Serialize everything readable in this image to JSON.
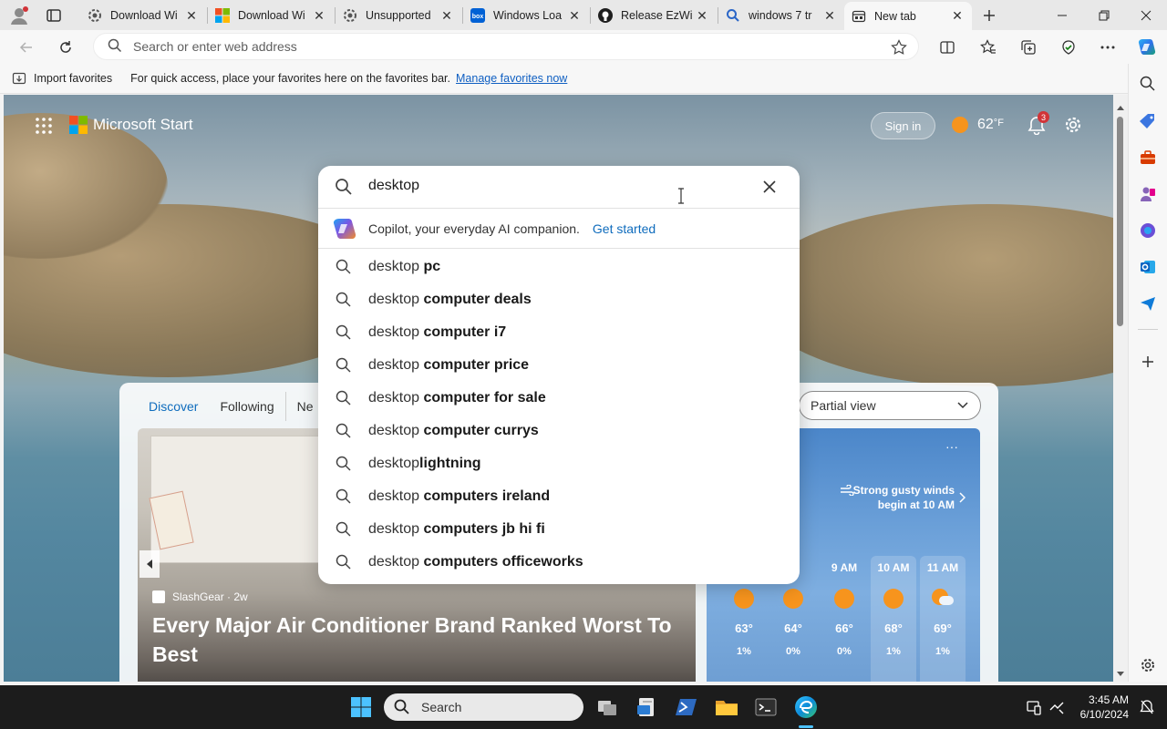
{
  "browser": {
    "tabs": [
      {
        "label": "Download Wi",
        "icon": "gear-icon"
      },
      {
        "label": "Download Wi",
        "icon": "microsoft-logo-icon"
      },
      {
        "label": "Unsupported",
        "icon": "gear-icon"
      },
      {
        "label": "Windows Loa",
        "icon": "box-icon"
      },
      {
        "label": "Release EzWi",
        "icon": "github-icon"
      },
      {
        "label": "windows 7 tr",
        "icon": "search-icon"
      },
      {
        "label": "New tab",
        "icon": "newtab-icon"
      }
    ],
    "address_placeholder": "Search or enter web address"
  },
  "favorites_bar": {
    "import_label": "Import favorites",
    "message": "For quick access, place your favorites here on the favorites bar.",
    "manage_link": "Manage favorites now"
  },
  "msstart": {
    "brand": "Microsoft Start",
    "sign_in": "Sign in",
    "temperature": "62",
    "temperature_unit": "°F",
    "notification_count": "3"
  },
  "search": {
    "query": "desktop",
    "copilot_text": "Copilot, your everyday AI companion.",
    "copilot_cta": "Get started",
    "suggestions": [
      {
        "prefix": "desktop ",
        "bold": "pc"
      },
      {
        "prefix": "desktop ",
        "bold": "computer deals"
      },
      {
        "prefix": "desktop ",
        "bold": "computer i7"
      },
      {
        "prefix": "desktop ",
        "bold": "computer price"
      },
      {
        "prefix": "desktop ",
        "bold": "computer for sale"
      },
      {
        "prefix": "desktop ",
        "bold": "computer currys"
      },
      {
        "prefix": "desktop",
        "bold": "lightning"
      },
      {
        "prefix": "desktop ",
        "bold": "computers ireland"
      },
      {
        "prefix": "desktop ",
        "bold": "computers jb hi fi"
      },
      {
        "prefix": "desktop ",
        "bold": "computers officeworks"
      }
    ]
  },
  "feed": {
    "tabs": [
      "Discover",
      "Following",
      "Ne"
    ],
    "view_select": "Partial view",
    "hero": {
      "source": "SlashGear · 2w",
      "headline": "Every Major Air Conditioner Brand Ranked Worst To Best"
    },
    "weather": {
      "big_temp_partial": "2",
      "unit": "°F",
      "alert": "Strong gusty winds begin at 10 AM",
      "tab_partial": "aily",
      "hours": [
        {
          "time": "M",
          "temp": "63°",
          "precip": "1%"
        },
        {
          "time": "M",
          "temp": "64°",
          "precip": "0%"
        },
        {
          "time": "9 AM",
          "temp": "66°",
          "precip": "0%"
        },
        {
          "time": "10 AM",
          "temp": "68°",
          "precip": "1%"
        },
        {
          "time": "11 AM",
          "temp": "69°",
          "precip": "1%"
        }
      ]
    }
  },
  "taskbar": {
    "search_label": "Search",
    "time": "3:45 AM",
    "date": "6/10/2024"
  },
  "colors": {
    "accent": "#0f6cbd",
    "link": "#0f5fc2"
  }
}
